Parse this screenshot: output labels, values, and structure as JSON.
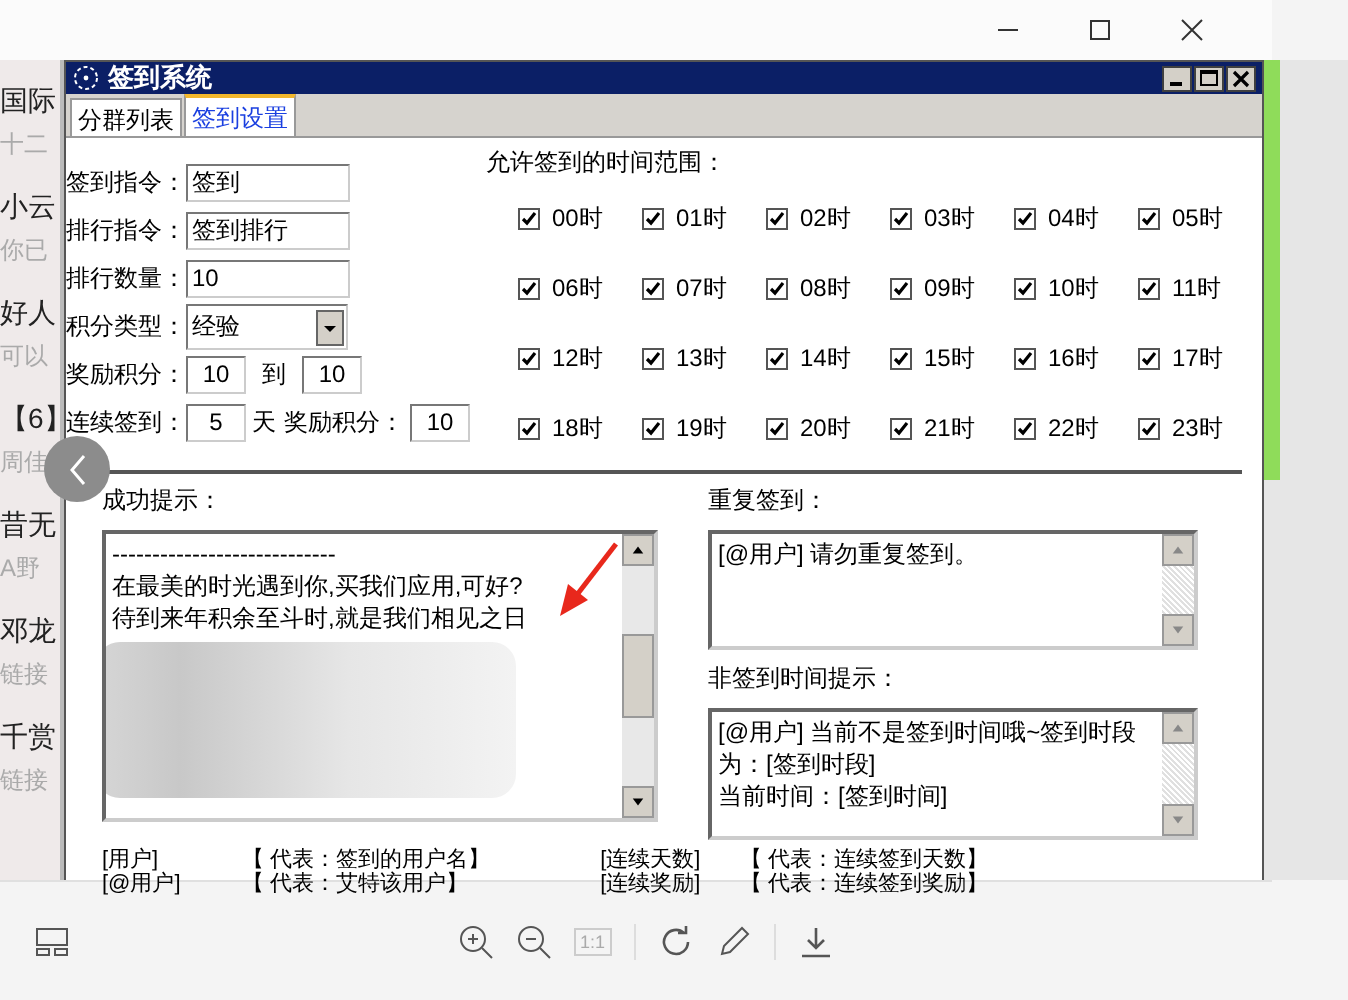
{
  "background_list": [
    {
      "text": "国际",
      "kind": "name"
    },
    {
      "text": "十二",
      "kind": "preview"
    },
    {
      "text": "小云",
      "kind": "name"
    },
    {
      "text": "你已",
      "kind": "preview"
    },
    {
      "text": "好人",
      "kind": "name"
    },
    {
      "text": "可以",
      "kind": "preview"
    },
    {
      "text": "【6】",
      "kind": "name"
    },
    {
      "text": "周佳",
      "kind": "preview"
    },
    {
      "text": "昔无",
      "kind": "name"
    },
    {
      "text": "A野",
      "kind": "preview"
    },
    {
      "text": "邓龙",
      "kind": "name"
    },
    {
      "text": "链接",
      "kind": "preview"
    },
    {
      "text": "千赏",
      "kind": "name"
    },
    {
      "text": "链接",
      "kind": "preview"
    }
  ],
  "window": {
    "title": "签到系统"
  },
  "tabs": [
    {
      "label": "分群列表",
      "selected": false
    },
    {
      "label": "签到设置",
      "selected": true
    }
  ],
  "fields": [
    {
      "label": "签到指令：",
      "value": "签到",
      "kind": "text"
    },
    {
      "label": "排行指令：",
      "value": "签到排行",
      "kind": "text"
    },
    {
      "label": "排行数量：",
      "value": "10",
      "kind": "text"
    },
    {
      "label": "积分类型：",
      "value": "经验",
      "kind": "select"
    }
  ],
  "reward_range": {
    "label": "奖励积分：",
    "from": "10",
    "to_label": "到",
    "to": "10"
  },
  "streak": {
    "label": "连续签到：",
    "days": "5",
    "days_unit": "天",
    "reward_label": "奖励积分：",
    "reward": "10"
  },
  "time_range": {
    "title": "允许签到的时间范围：",
    "hours": [
      {
        "label": "00时",
        "checked": true
      },
      {
        "label": "01时",
        "checked": true
      },
      {
        "label": "02时",
        "checked": true
      },
      {
        "label": "03时",
        "checked": true
      },
      {
        "label": "04时",
        "checked": true
      },
      {
        "label": "05时",
        "checked": true
      },
      {
        "label": "06时",
        "checked": true
      },
      {
        "label": "07时",
        "checked": true
      },
      {
        "label": "08时",
        "checked": true
      },
      {
        "label": "09时",
        "checked": true
      },
      {
        "label": "10时",
        "checked": true
      },
      {
        "label": "11时",
        "checked": true
      },
      {
        "label": "12时",
        "checked": true
      },
      {
        "label": "13时",
        "checked": true
      },
      {
        "label": "14时",
        "checked": true
      },
      {
        "label": "15时",
        "checked": true
      },
      {
        "label": "16时",
        "checked": true
      },
      {
        "label": "17时",
        "checked": true
      },
      {
        "label": "18时",
        "checked": true
      },
      {
        "label": "19时",
        "checked": true
      },
      {
        "label": "20时",
        "checked": true
      },
      {
        "label": "21时",
        "checked": true
      },
      {
        "label": "22时",
        "checked": true
      },
      {
        "label": "23时",
        "checked": true
      }
    ]
  },
  "success_message": {
    "label": "成功提示：",
    "lines": [
      "----------------------------",
      "在最美的时光遇到你,买我们应用,可好?",
      "待到来年积余至斗时,就是我们相见之日"
    ]
  },
  "repeat_message": {
    "label": "重复签到：",
    "lines": [
      "[@用户] 请勿重复签到。"
    ]
  },
  "off_time_message": {
    "label": "非签到时间提示：",
    "lines": [
      "[@用户] 当前不是签到时间哦~签到时段为：[签到时段]",
      "当前时间：[签到时间]"
    ]
  },
  "legend_left": [
    {
      "token": "[用户]",
      "meaning": "【 代表：签到的用户名】"
    },
    {
      "token": "[@用户]",
      "meaning": "【 代表：艾特该用户】"
    }
  ],
  "legend_right": [
    {
      "token": "[连续天数]",
      "meaning": "【 代表：连续签到天数】"
    },
    {
      "token": "[连续奖励]",
      "meaning": "【 代表：连续签到奖励】"
    }
  ],
  "toolbar": {
    "actual_size": "1:1"
  }
}
